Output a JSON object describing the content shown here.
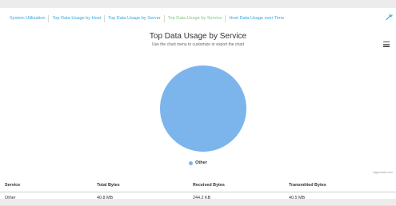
{
  "tabs": [
    {
      "label": "System Utilisation",
      "active": false
    },
    {
      "label": "Top Data Usage by Host",
      "active": false
    },
    {
      "label": "Top Data Usage by Server",
      "active": false
    },
    {
      "label": "Top Data Usage by Service",
      "active": true
    },
    {
      "label": "Host Data Usage over Time",
      "active": false
    }
  ],
  "toolbar": {
    "wrench_icon": "wrench-icon",
    "menu_icon": "hamburger-menu-icon"
  },
  "chart_data": {
    "type": "pie",
    "title": "Top Data Usage by Service",
    "subtitle": "Use the chart menu to customize or export the chart",
    "slices": [
      {
        "name": "Other",
        "value": 100,
        "color": "#7cb5ec"
      }
    ],
    "legend": {
      "placement": "bottom-center",
      "entries": [
        "Other"
      ]
    },
    "credits": "Highcharts.com"
  },
  "table": {
    "headers": [
      "Service",
      "Total Bytes",
      "Received Bytes",
      "Transmitted Bytes"
    ],
    "rows": [
      [
        "Other",
        "40.8 MB",
        "244.2 KB",
        "40.5 MB"
      ]
    ]
  },
  "colors": {
    "tab_link": "#35a7d8",
    "tab_active": "#7cc77f",
    "pie_fill": "#7cb5ec"
  }
}
